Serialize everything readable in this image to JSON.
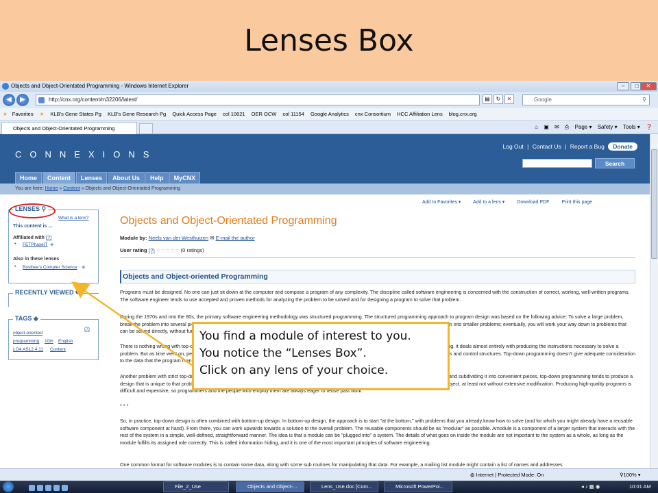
{
  "slide": {
    "title": "Lenses Box"
  },
  "window": {
    "title": "Objects and Object-Orientated Programming - Windows Internet Explorer",
    "minimize": "–",
    "maximize": "□",
    "close": "✕"
  },
  "addressbar": {
    "url": "http://cnx.org/content/m32206/latest/",
    "search_placeholder": "Google"
  },
  "favorites": [
    "Favorites",
    "KLB's Gene States Pg",
    "KLB's Gene Research Pg",
    "Quick Access Page",
    "col 10621",
    "OER OCW",
    "col 11154",
    "Google Analytics",
    "cnx Consortium",
    "HCC Affiliation Lens",
    "blog.cnx.org"
  ],
  "tab": {
    "label": "Objects and Object-Orientated Programming"
  },
  "commandbar": [
    "Page ▾",
    "Safety ▾",
    "Tools ▾"
  ],
  "site": {
    "logo": "CONNEXIONS",
    "top_links": [
      "Log Out",
      "|",
      "Contact Us",
      "|",
      "Report a Bug"
    ],
    "donate": "Donate",
    "search_button": "Search",
    "nav": [
      "Home",
      "Content",
      "Lenses",
      "About Us",
      "Help",
      "MyCNX"
    ],
    "breadcrumb_prefix": "You are here: ",
    "breadcrumb_home": "Home",
    "breadcrumb_sep1": " » ",
    "breadcrumb_content": "Content",
    "breadcrumb_sep2": " » Objects and Object-Orientated Programming"
  },
  "lenses_box": {
    "title": "LENSES",
    "what_is": "What is a lens?",
    "intro": "This content is ...",
    "affiliated_label": "Affiliated with",
    "affiliated_help": "(?)",
    "affiliated_item": "FETPhaseIT",
    "also_label": "Also in these lenses",
    "also_item": "Busibee's Compter Science"
  },
  "recently_viewed": {
    "title": "RECENTLY VIEWED ▾"
  },
  "tags_box": {
    "title": "TAGS",
    "help": "(?)",
    "tags": [
      "object-oriented",
      "programming",
      "10th",
      "English",
      "LO4:AS12.4.11",
      "Content"
    ]
  },
  "actions": [
    "Add to Favorites ▾",
    "Add to a lens ▾",
    "Download PDF",
    "Print this page"
  ],
  "module": {
    "title": "Objects and Object-Orientated Programming",
    "by_label": "Module by:",
    "author": "Neels van der Westhuizen",
    "email": "E-mail the author",
    "rating_label": "User rating",
    "rating_help": "(?)",
    "stars": "☆☆☆☆☆",
    "rating_count": "(0 ratings)",
    "section_title": "Objects and Object-oriented Programming",
    "paragraphs": [
      "Programs must be designed. No one can just sit down at the computer and compose a program of any complexity. The discipline called software engineering is concerned with the construction of correct, working, well-written programs. The software engineer tends to use accepted and proven methods for analyzing the problem to be solved and for designing a program to solve that problem.",
      "During the 1970s and into the 80s, the primary software engineering methodology was structured programming. The structured programming approach to program design was based on the following advice: To solve a large problem, break the problem into several pieces and work on each piece separately; to solve each piece, treat it as a new problem which can itself be broken down into smaller problems; eventually, you will work your way down to problems that can be solved directly, without further decomposition. This approach is called top-down programming.",
      "There is nothing wrong with top-down programming. It is a valuable and often-used approach to problem-solving. However, it is incomplete. For one thing, it deals almost entirely with producing the instructions necessary to solve a problem. But as time went on, people realized that the design of the data structures for a program was as least as important as the design of subroutines and control structures. Top-down programming doesn't give adequate consideration to the data that the program manipulates.",
      "Another problem with strict top-down programming is that it makes it difficult to reuse work done for other projects. By starting with a particular problem and subdividing it into convenient pieces, top-down programming tends to produce a design that is unique to that problem. It is unlikely that you will be able to take a large chunk of programming from another program and fit it into your project, at least not without extensive modification. Producing high-quality programs is difficult and expensive, so programmers and the people who employ them are always eager to reuse past work.",
      "* * *",
      "So, in practice, top-down design is often combined with bottom-up design. In bottom-up design, the approach is to start \"at the bottom,\" with problems that you already know how to solve (and for which you might already have a reusable software component at hand). From there, you can work upwards towards a solution to the overall problem. The reusable components should be as \"modular\" as possible. Amodule is a component of a larger system that interacts with the rest of the system in a simple, well-defined, straightforward manner. The idea is that a module can be \"plugged into\" a system. The details of what goes on inside the module are not important to the system as a whole, as long as the module fulfills its assigned role correctly. This is called information hiding, and it is one of the most important principles of software engineering.",
      "One common format for software modules is to contain some data, along with some sub routines for manipulating that data. For example, a mailing list module might contain a list of names and addresses"
    ]
  },
  "callout": {
    "lines": [
      "You find a module of interest to you.",
      "You notice the “Lenses Box”.",
      "Click on any lens of your choice."
    ],
    "border_color": "#f2b62a"
  },
  "statusbar": {
    "zone": "Internet | Protected Mode: On",
    "zoom": "100%"
  },
  "taskbar": {
    "buttons": [
      "File_2_Use",
      "Objects and Object-...",
      "Lens_Use.doc [Com...",
      "Microsoft PowerPoi..."
    ],
    "time": "10:01 AM"
  },
  "colors": {
    "title_band": "#fbc99e",
    "cnx_blue": "#2c5d96",
    "module_title": "#e07b1a",
    "highlight_ring": "#d62020"
  }
}
